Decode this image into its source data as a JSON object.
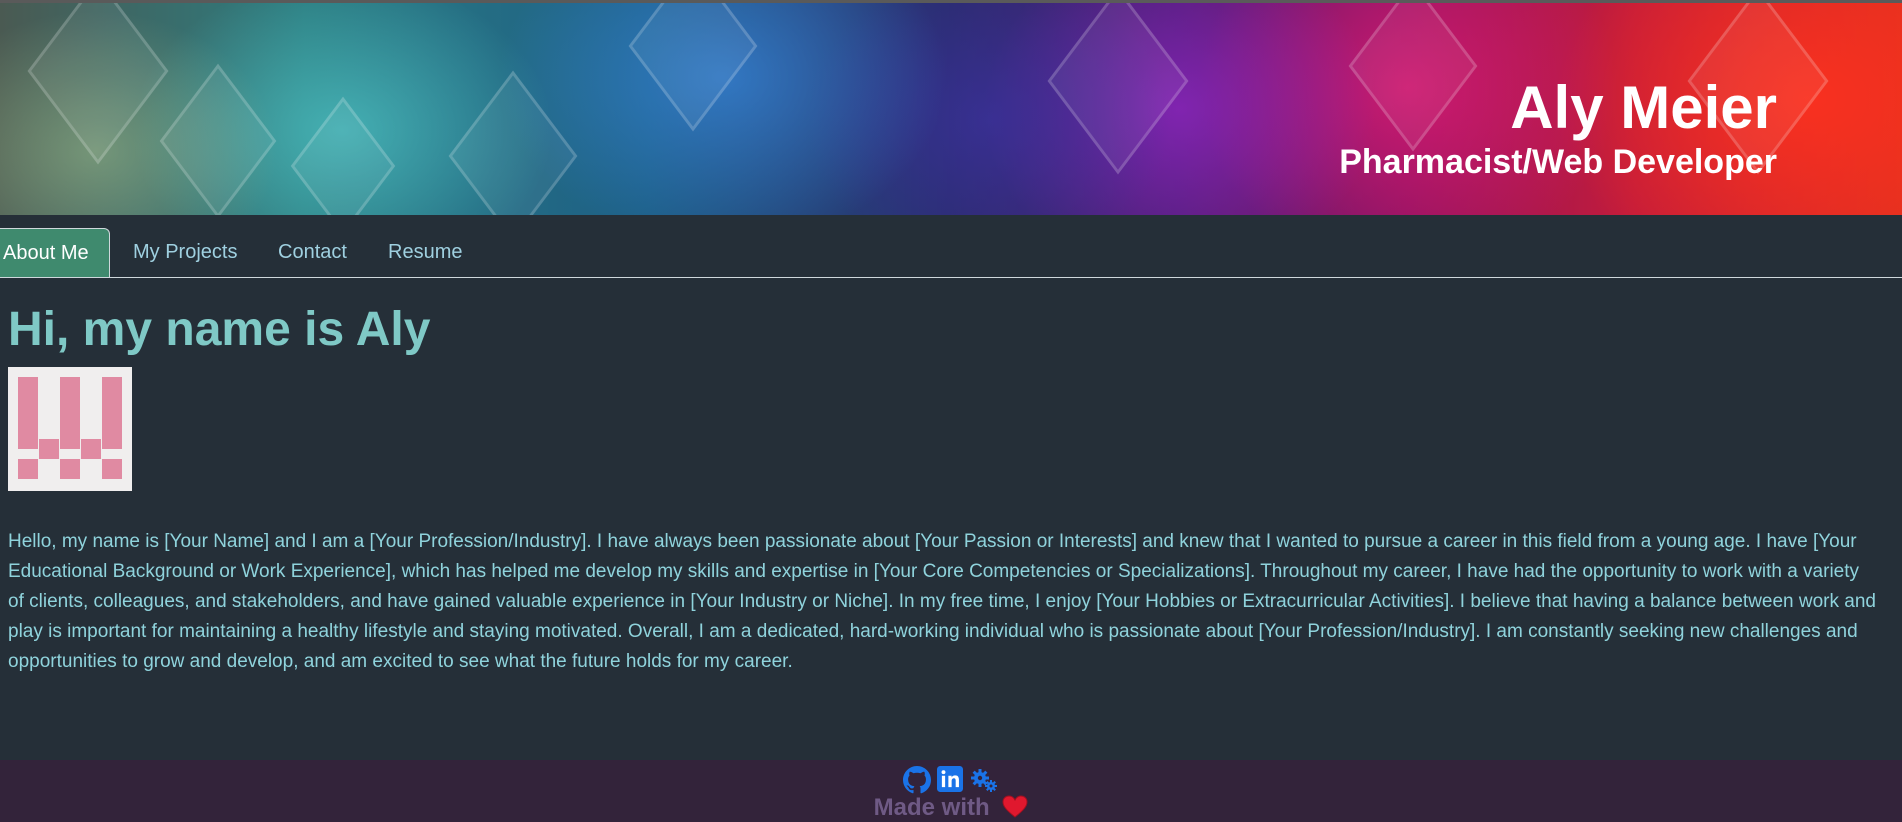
{
  "header": {
    "name": "Aly Meier",
    "role": "Pharmacist/Web Developer"
  },
  "nav": {
    "tabs": [
      {
        "label": "About Me",
        "active": true
      },
      {
        "label": "My Projects",
        "active": false
      },
      {
        "label": "Contact",
        "active": false
      },
      {
        "label": "Resume",
        "active": false
      }
    ]
  },
  "main": {
    "heading": "Hi, my name is Aly",
    "bio": "Hello, my name is [Your Name] and I am a [Your Profession/Industry]. I have always been passionate about [Your Passion or Interests] and knew that I wanted to pursue a career in this field from a young age. I have [Your Educational Background or Work Experience], which has helped me develop my skills and expertise in [Your Core Competencies or Specializations]. Throughout my career, I have had the opportunity to work with a variety of clients, colleagues, and stakeholders, and have gained valuable experience in [Your Industry or Niche]. In my free time, I enjoy [Your Hobbies or Extracurricular Activities]. I believe that having a balance between work and play is important for maintaining a healthy lifestyle and staying motivated. Overall, I am a dedicated, hard-working individual who is passionate about [Your Profession/Industry]. I am constantly seeking new challenges and opportunities to grow and develop, and am excited to see what the future holds for my career."
  },
  "footer": {
    "made_with": "Made with",
    "icons": [
      "github-icon",
      "linkedin-icon",
      "gears-icon",
      "heart-icon"
    ]
  },
  "colors": {
    "background": "#252f38",
    "accent_tab": "#3f8a6e",
    "heading": "#7fc9c6",
    "text": "#8fd3dc",
    "footer_bg": "#33233a",
    "footer_text": "#6f5a85",
    "icon_blue": "#1a73e8",
    "heart": "#e0182e"
  }
}
